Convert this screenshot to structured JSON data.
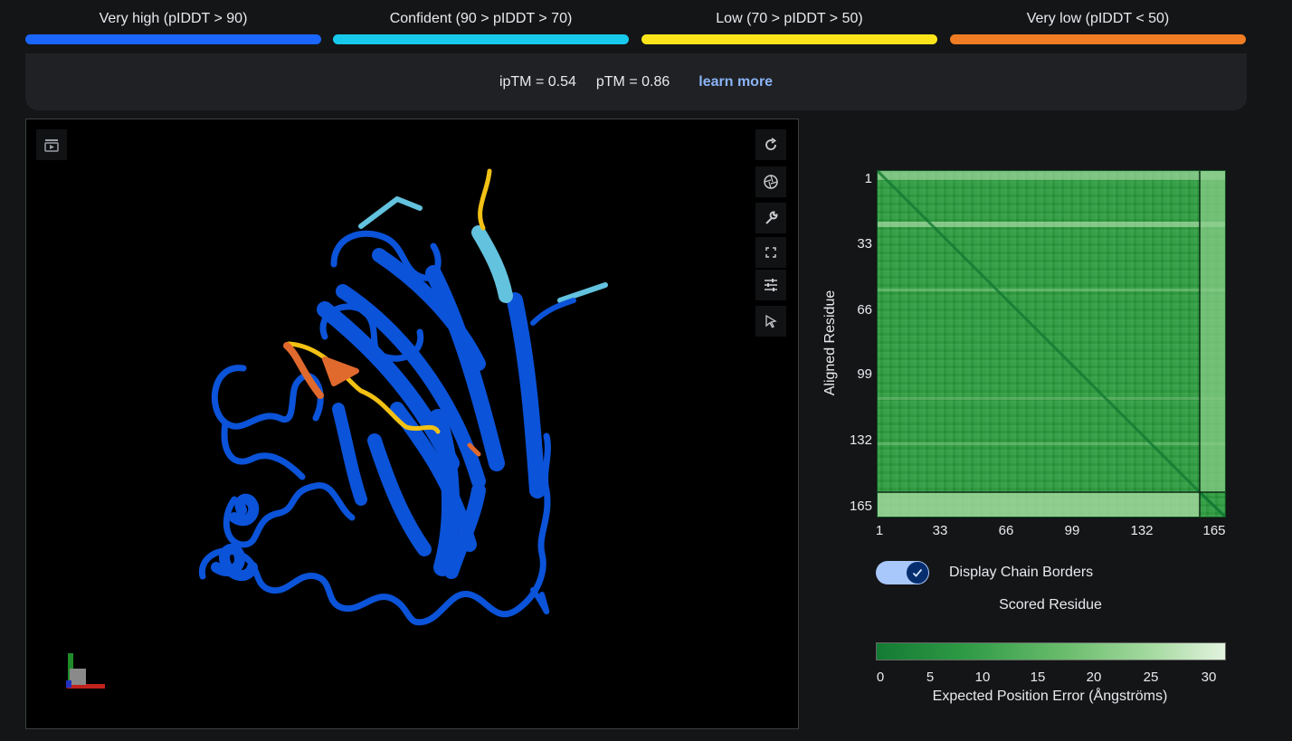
{
  "legend": [
    {
      "label": "Very high (pIDDT > 90)",
      "color": "#1a66ff"
    },
    {
      "label": "Confident (90 > pIDDT > 70)",
      "color": "#17c9ea"
    },
    {
      "label": "Low (70 > pIDDT > 50)",
      "color": "#fbe51a"
    },
    {
      "label": "Very low (pIDDT < 50)",
      "color": "#f07d24"
    }
  ],
  "metrics": {
    "iptm": "ipTM = 0.54",
    "ptm": "pTM = 0.86",
    "learn_more": "learn more"
  },
  "viewer": {
    "tools": [
      "animation-icon",
      "rotate-icon",
      "aperture-icon",
      "wrench-icon",
      "fullscreen-icon",
      "sliders-icon",
      "cursor-icon"
    ],
    "structure_colors": {
      "very_high": "#0b53d9",
      "confident": "#63c2de",
      "low": "#f2c114",
      "very_low": "#e0692e"
    }
  },
  "pae": {
    "y_axis_label": "Aligned Residue",
    "x_axis_label": "Scored Residue",
    "ticks": [
      "1",
      "33",
      "66",
      "99",
      "132",
      "165"
    ],
    "chain_border_label": "Display Chain Borders",
    "chain_borders_on": true,
    "colorbar_ticks": [
      "0",
      "5",
      "10",
      "15",
      "20",
      "25",
      "30"
    ],
    "colorbar_label": "Expected Position Error (Ångströms)",
    "colors": {
      "low_error": "#137a33",
      "high_error": "#e3f3df"
    }
  }
}
